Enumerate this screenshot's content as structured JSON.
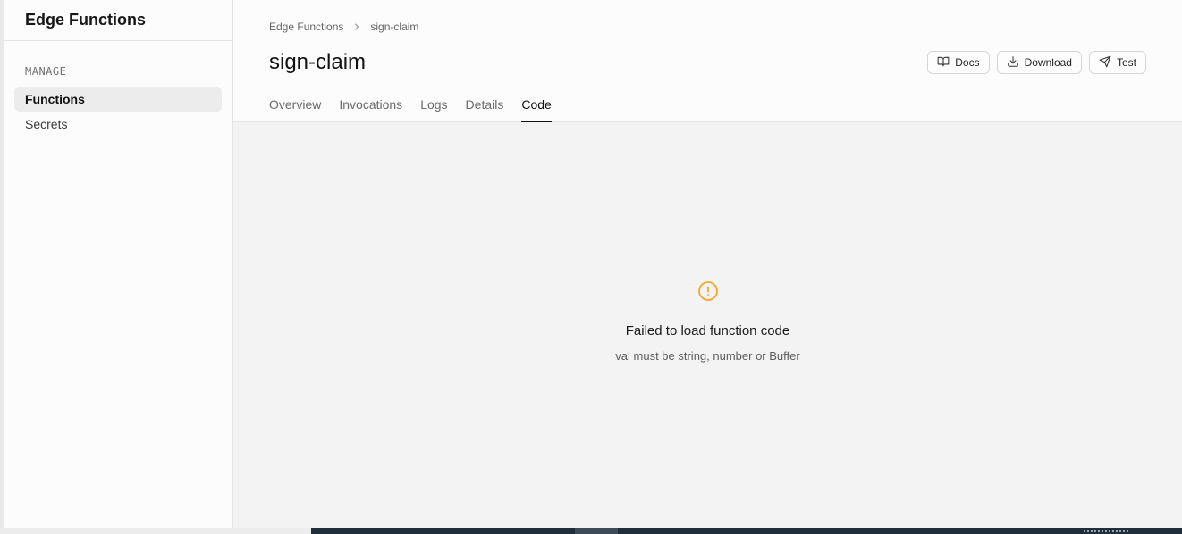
{
  "sidebar": {
    "title": "Edge Functions",
    "section_label": "MANAGE",
    "items": [
      {
        "label": "Functions",
        "active": true
      },
      {
        "label": "Secrets",
        "active": false
      }
    ]
  },
  "breadcrumb": {
    "root": "Edge Functions",
    "current": "sign-claim"
  },
  "page": {
    "title": "sign-claim"
  },
  "actions": {
    "docs_label": "Docs",
    "download_label": "Download",
    "test_label": "Test"
  },
  "tabs": [
    {
      "label": "Overview",
      "active": false
    },
    {
      "label": "Invocations",
      "active": false
    },
    {
      "label": "Logs",
      "active": false
    },
    {
      "label": "Details",
      "active": false
    },
    {
      "label": "Code",
      "active": true
    }
  ],
  "error": {
    "icon": "alert-circle-icon",
    "title": "Failed to load function code",
    "message": "val must be string, number or Buffer",
    "icon_color": "#f0a92b"
  },
  "colors": {
    "accent_text": "#111111",
    "taskbar": "#202d3a"
  }
}
